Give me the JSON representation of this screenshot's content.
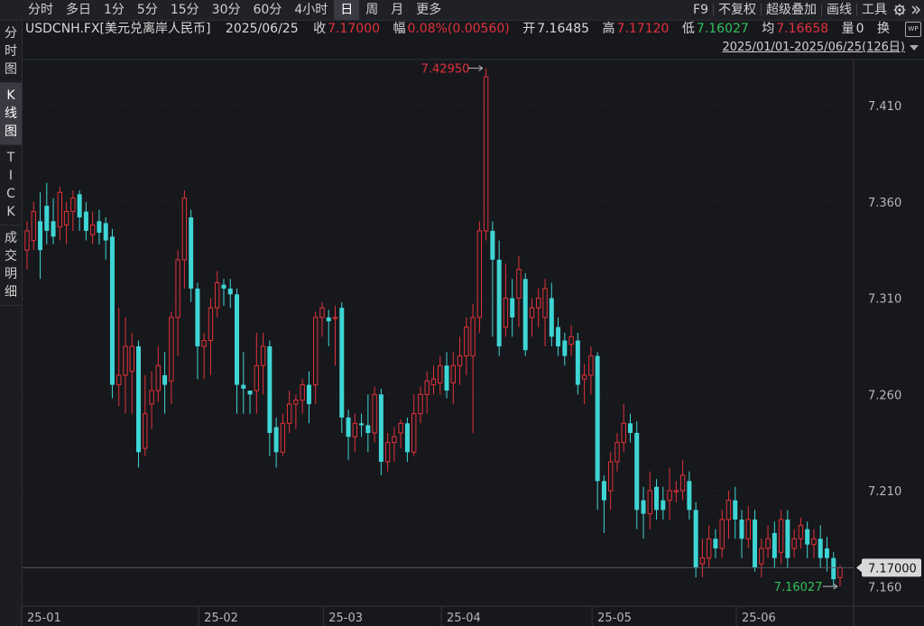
{
  "period_tabs": [
    "分时",
    "多日",
    "1分",
    "5分",
    "15分",
    "30分",
    "60分",
    "4小时",
    "日",
    "周",
    "月",
    "更多"
  ],
  "active_period": "日",
  "toolbar": {
    "f9": "F9",
    "fuquan": "不复权",
    "overlay": "超级叠加",
    "draw": "画线",
    "tools": "工具"
  },
  "side_tabs": [
    [
      "分",
      "时",
      "图"
    ],
    [
      "K",
      "线",
      "图"
    ],
    [
      "T",
      "I",
      "C",
      "K"
    ],
    [
      "成",
      "交",
      "明",
      "细"
    ]
  ],
  "active_side_tab": 1,
  "info": {
    "symbol": "USDCNH.FX[美元兑离岸人民币]",
    "date": "2025/06/25",
    "close_label": "收",
    "close": "7.17000",
    "chg_label": "幅",
    "chg": "0.08%(0.00560)",
    "open_label": "开",
    "open": "7.16485",
    "high_label": "高",
    "high": "7.17120",
    "low_label": "低",
    "low": "7.16027",
    "avg_label": "均",
    "avg": "7.16658",
    "vol_label": "量",
    "vol": "0",
    "turnover_label": "换"
  },
  "range": "2025/01/01-2025/06/25(126日)",
  "colors": {
    "up": "#e0323a",
    "down": "#3fd5d5",
    "bg": "#17181c",
    "grid": "#2a2b30",
    "accent": "#e0323a",
    "low_label": "#2fc25b"
  },
  "chart_data": {
    "type": "candlestick",
    "ylim": [
      7.15,
      7.434
    ],
    "yticks": [
      "7.160",
      "7.210",
      "7.260",
      "7.310",
      "7.360",
      "7.410"
    ],
    "xlabels": [
      "25-01",
      "25-02",
      "25-03",
      "25-04",
      "25-05",
      "25-06"
    ],
    "xlabel_index": [
      0,
      27,
      46,
      64,
      87,
      109
    ],
    "max_label": "7.42950",
    "max_index": 70,
    "min_label": "7.16027",
    "min_index": 123,
    "last_price": "7.17000",
    "candles": [
      [
        7.335,
        7.345,
        7.325,
        7.35
      ],
      [
        7.34,
        7.355,
        7.335,
        7.36
      ],
      [
        7.35,
        7.335,
        7.32,
        7.365
      ],
      [
        7.358,
        7.345,
        7.338,
        7.37
      ],
      [
        7.35,
        7.342,
        7.338,
        7.362
      ],
      [
        7.347,
        7.365,
        7.34,
        7.368
      ],
      [
        7.348,
        7.355,
        7.338,
        7.36
      ],
      [
        7.355,
        7.362,
        7.345,
        7.366
      ],
      [
        7.364,
        7.352,
        7.345,
        7.366
      ],
      [
        7.355,
        7.345,
        7.34,
        7.36
      ],
      [
        7.343,
        7.348,
        7.338,
        7.355
      ],
      [
        7.35,
        7.344,
        7.338,
        7.356
      ],
      [
        7.349,
        7.34,
        7.33,
        7.352
      ],
      [
        7.342,
        7.265,
        7.258,
        7.346
      ],
      [
        7.265,
        7.27,
        7.254,
        7.305
      ],
      [
        7.27,
        7.285,
        7.25,
        7.3
      ],
      [
        7.272,
        7.285,
        7.25,
        7.292
      ],
      [
        7.285,
        7.23,
        7.222,
        7.288
      ],
      [
        7.232,
        7.25,
        7.228,
        7.27
      ],
      [
        7.255,
        7.262,
        7.242,
        7.272
      ],
      [
        7.262,
        7.275,
        7.256,
        7.285
      ],
      [
        7.27,
        7.265,
        7.25,
        7.282
      ],
      [
        7.267,
        7.3,
        7.255,
        7.303
      ],
      [
        7.3,
        7.33,
        7.28,
        7.335
      ],
      [
        7.33,
        7.362,
        7.315,
        7.366
      ],
      [
        7.352,
        7.315,
        7.308,
        7.356
      ],
      [
        7.315,
        7.285,
        7.268,
        7.318
      ],
      [
        7.285,
        7.288,
        7.268,
        7.292
      ],
      [
        7.288,
        7.305,
        7.27,
        7.31
      ],
      [
        7.305,
        7.318,
        7.3,
        7.324
      ],
      [
        7.317,
        7.315,
        7.306,
        7.32
      ],
      [
        7.315,
        7.312,
        7.305,
        7.32
      ],
      [
        7.312,
        7.265,
        7.25,
        7.315
      ],
      [
        7.265,
        7.263,
        7.25,
        7.282
      ],
      [
        7.262,
        7.26,
        7.25,
        7.262
      ],
      [
        7.262,
        7.275,
        7.25,
        7.292
      ],
      [
        7.275,
        7.285,
        7.26,
        7.292
      ],
      [
        7.285,
        7.24,
        7.228,
        7.288
      ],
      [
        7.243,
        7.23,
        7.222,
        7.248
      ],
      [
        7.23,
        7.245,
        7.228,
        7.25
      ],
      [
        7.245,
        7.255,
        7.24,
        7.262
      ],
      [
        7.255,
        7.257,
        7.242,
        7.26
      ],
      [
        7.257,
        7.265,
        7.25,
        7.268
      ],
      [
        7.265,
        7.255,
        7.245,
        7.272
      ],
      [
        7.265,
        7.3,
        7.255,
        7.303
      ],
      [
        7.3,
        7.305,
        7.29,
        7.308
      ],
      [
        7.3,
        7.298,
        7.285,
        7.304
      ],
      [
        7.3,
        7.3,
        7.275,
        7.306
      ],
      [
        7.305,
        7.248,
        7.24,
        7.308
      ],
      [
        7.248,
        7.238,
        7.226,
        7.252
      ],
      [
        7.238,
        7.245,
        7.23,
        7.25
      ],
      [
        7.245,
        7.244,
        7.238,
        7.25
      ],
      [
        7.244,
        7.24,
        7.23,
        7.26
      ],
      [
        7.24,
        7.26,
        7.235,
        7.264
      ],
      [
        7.26,
        7.225,
        7.218,
        7.263
      ],
      [
        7.225,
        7.235,
        7.22,
        7.24
      ],
      [
        7.235,
        7.238,
        7.225,
        7.243
      ],
      [
        7.24,
        7.245,
        7.232,
        7.247
      ],
      [
        7.245,
        7.23,
        7.225,
        7.248
      ],
      [
        7.23,
        7.25,
        7.228,
        7.26
      ],
      [
        7.25,
        7.26,
        7.245,
        7.264
      ],
      [
        7.26,
        7.267,
        7.25,
        7.272
      ],
      [
        7.265,
        7.268,
        7.26,
        7.275
      ],
      [
        7.266,
        7.275,
        7.26,
        7.28
      ],
      [
        7.275,
        7.262,
        7.258,
        7.282
      ],
      [
        7.266,
        7.275,
        7.255,
        7.282
      ],
      [
        7.275,
        7.28,
        7.265,
        7.29
      ],
      [
        7.28,
        7.295,
        7.27,
        7.3
      ],
      [
        7.28,
        7.3,
        7.24,
        7.307
      ],
      [
        7.3,
        7.345,
        7.292,
        7.35
      ],
      [
        7.345,
        7.425,
        7.34,
        7.4295
      ],
      [
        7.345,
        7.33,
        7.29,
        7.35
      ],
      [
        7.33,
        7.285,
        7.28,
        7.34
      ],
      [
        7.295,
        7.31,
        7.29,
        7.328
      ],
      [
        7.31,
        7.3,
        7.29,
        7.32
      ],
      [
        7.31,
        7.325,
        7.295,
        7.332
      ],
      [
        7.32,
        7.283,
        7.28,
        7.323
      ],
      [
        7.3,
        7.305,
        7.29,
        7.31
      ],
      [
        7.305,
        7.31,
        7.295,
        7.315
      ],
      [
        7.3,
        7.315,
        7.285,
        7.32
      ],
      [
        7.31,
        7.29,
        7.285,
        7.318
      ],
      [
        7.295,
        7.285,
        7.28,
        7.3
      ],
      [
        7.288,
        7.28,
        7.275,
        7.292
      ],
      [
        7.286,
        7.29,
        7.28,
        7.296
      ],
      [
        7.288,
        7.265,
        7.26,
        7.292
      ],
      [
        7.268,
        7.27,
        7.255,
        7.276
      ],
      [
        7.27,
        7.28,
        7.26,
        7.285
      ],
      [
        7.28,
        7.215,
        7.2,
        7.282
      ],
      [
        7.215,
        7.205,
        7.188,
        7.218
      ],
      [
        7.21,
        7.225,
        7.2,
        7.23
      ],
      [
        7.225,
        7.235,
        7.22,
        7.24
      ],
      [
        7.235,
        7.245,
        7.23,
        7.255
      ],
      [
        7.245,
        7.24,
        7.235,
        7.25
      ],
      [
        7.24,
        7.2,
        7.19,
        7.246
      ],
      [
        7.205,
        7.198,
        7.185,
        7.212
      ],
      [
        7.198,
        7.21,
        7.19,
        7.22
      ],
      [
        7.212,
        7.2,
        7.195,
        7.216
      ],
      [
        7.205,
        7.2,
        7.195,
        7.212
      ],
      [
        7.205,
        7.21,
        7.195,
        7.222
      ],
      [
        7.21,
        7.21,
        7.204,
        7.215
      ],
      [
        7.21,
        7.218,
        7.205,
        7.226
      ],
      [
        7.215,
        7.2,
        7.195,
        7.22
      ],
      [
        7.2,
        7.17,
        7.165,
        7.204
      ],
      [
        7.172,
        7.175,
        7.165,
        7.185
      ],
      [
        7.175,
        7.185,
        7.17,
        7.192
      ],
      [
        7.185,
        7.18,
        7.175,
        7.19
      ],
      [
        7.18,
        7.195,
        7.175,
        7.2
      ],
      [
        7.195,
        7.205,
        7.185,
        7.21
      ],
      [
        7.205,
        7.195,
        7.185,
        7.212
      ],
      [
        7.195,
        7.185,
        7.175,
        7.2
      ],
      [
        7.185,
        7.195,
        7.18,
        7.202
      ],
      [
        7.195,
        7.17,
        7.168,
        7.2
      ],
      [
        7.172,
        7.18,
        7.165,
        7.185
      ],
      [
        7.18,
        7.185,
        7.175,
        7.192
      ],
      [
        7.188,
        7.175,
        7.17,
        7.194
      ],
      [
        7.178,
        7.195,
        7.172,
        7.2
      ],
      [
        7.195,
        7.175,
        7.17,
        7.2
      ],
      [
        7.18,
        7.185,
        7.175,
        7.19
      ],
      [
        7.185,
        7.192,
        7.18,
        7.196
      ],
      [
        7.19,
        7.182,
        7.175,
        7.194
      ],
      [
        7.182,
        7.185,
        7.175,
        7.19
      ],
      [
        7.185,
        7.175,
        7.17,
        7.192
      ],
      [
        7.18,
        7.175,
        7.168,
        7.186
      ],
      [
        7.175,
        7.164,
        7.16,
        7.178
      ],
      [
        7.1648,
        7.17,
        7.1603,
        7.1712
      ]
    ]
  }
}
